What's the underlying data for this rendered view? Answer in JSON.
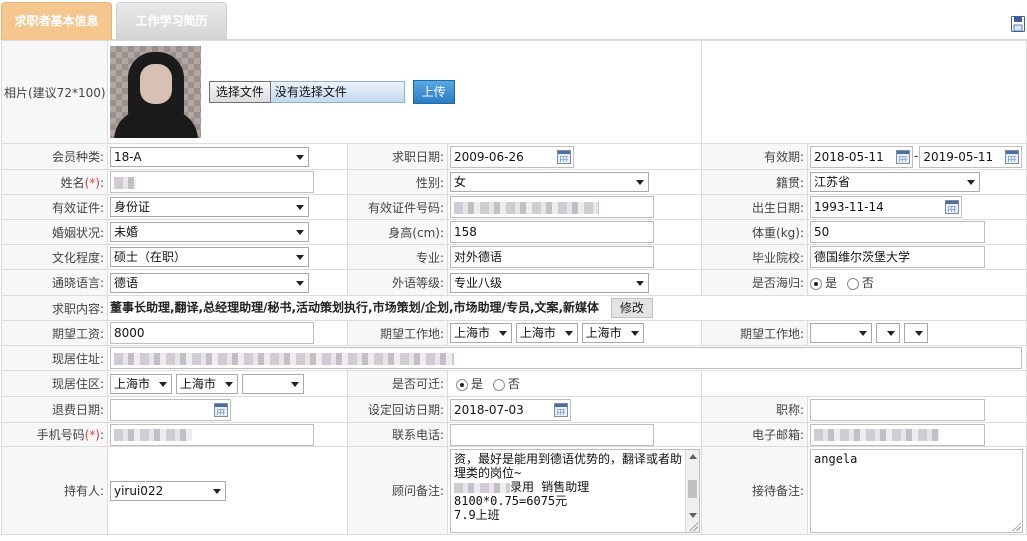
{
  "tabs": [
    {
      "label": "求职者基本信息",
      "active": true
    },
    {
      "label": "工作学习简历",
      "active": false
    }
  ],
  "photo": {
    "label": "相片(建议72*100):",
    "choose_button": "选择文件",
    "file_status": "没有选择文件",
    "upload_button": "上传"
  },
  "fields": {
    "member_type": {
      "label": "会员种类:",
      "value": "18-A"
    },
    "apply_date": {
      "label": "求职日期:",
      "value": "2009-06-26"
    },
    "valid_period": {
      "label": "有效期:",
      "from": "2018-05-11",
      "sep": "-",
      "to": "2019-05-11"
    },
    "name": {
      "label": "姓名",
      "req": "(*)",
      "colon": ":"
    },
    "gender": {
      "label": "性别:",
      "value": "女"
    },
    "native_place": {
      "label": "籍贯:",
      "value": "江苏省"
    },
    "id_type": {
      "label": "有效证件:",
      "value": "身份证"
    },
    "id_number": {
      "label": "有效证件号码:"
    },
    "birth_date": {
      "label": "出生日期:",
      "value": "1993-11-14"
    },
    "marital": {
      "label": "婚姻状况:",
      "value": "未婚"
    },
    "height": {
      "label": "身高(cm):",
      "value": "158"
    },
    "weight": {
      "label": "体重(kg):",
      "value": "50"
    },
    "education": {
      "label": "文化程度:",
      "value": "硕士（在职）"
    },
    "major": {
      "label": "专业:",
      "value": "对外德语"
    },
    "school": {
      "label": "毕业院校:",
      "value": "德国维尔茨堡大学"
    },
    "language": {
      "label": "通晓语言:",
      "value": "德语"
    },
    "language_level": {
      "label": "外语等级:",
      "value": "专业八级"
    },
    "returnee": {
      "label": "是否海归:",
      "yes": "是",
      "no": "否",
      "selected": "yes"
    },
    "job_content": {
      "label": "求职内容:",
      "value": "董事长助理,翻译,总经理助理/秘书,活动策划执行,市场策划/企划,市场助理/专员,文案,新媒体",
      "modify_button": "修改"
    },
    "salary": {
      "label": "期望工资:",
      "value": "8000"
    },
    "work_location1": {
      "label": "期望工作地:",
      "a": "上海市",
      "b": "上海市",
      "c": "上海市"
    },
    "work_location2": {
      "label": "期望工作地:"
    },
    "address": {
      "label": "现居住址:"
    },
    "district": {
      "label": "现居住区:",
      "a": "上海市",
      "b": "上海市"
    },
    "relocate": {
      "label": "是否可迁:",
      "yes": "是",
      "no": "否",
      "selected": "yes"
    },
    "refund_date": {
      "label": "退费日期:"
    },
    "callback_date": {
      "label": "设定回访日期:",
      "value": "2018-07-03"
    },
    "title": {
      "label": "职称:"
    },
    "mobile": {
      "label": "手机号码",
      "req": "(*)",
      "colon": ":"
    },
    "phone": {
      "label": "联系电话:"
    },
    "email": {
      "label": "电子邮箱:"
    },
    "owner": {
      "label": "持有人:",
      "value": "yirui022"
    },
    "advisor_note": {
      "label": "顾问备注:",
      "line1": "资，最好是能用到德语优势的，翻译或者助理类的岗位~",
      "line2": "录用   销售助理",
      "line3": "8100*0.75=6075元",
      "line4": "7.9上班"
    },
    "reception_note": {
      "label": "接待备注:",
      "value": "angela"
    }
  },
  "colors": {
    "tab_active": "#f6c68f",
    "upload": "#2b7cc4",
    "required": "#e53a3a"
  }
}
